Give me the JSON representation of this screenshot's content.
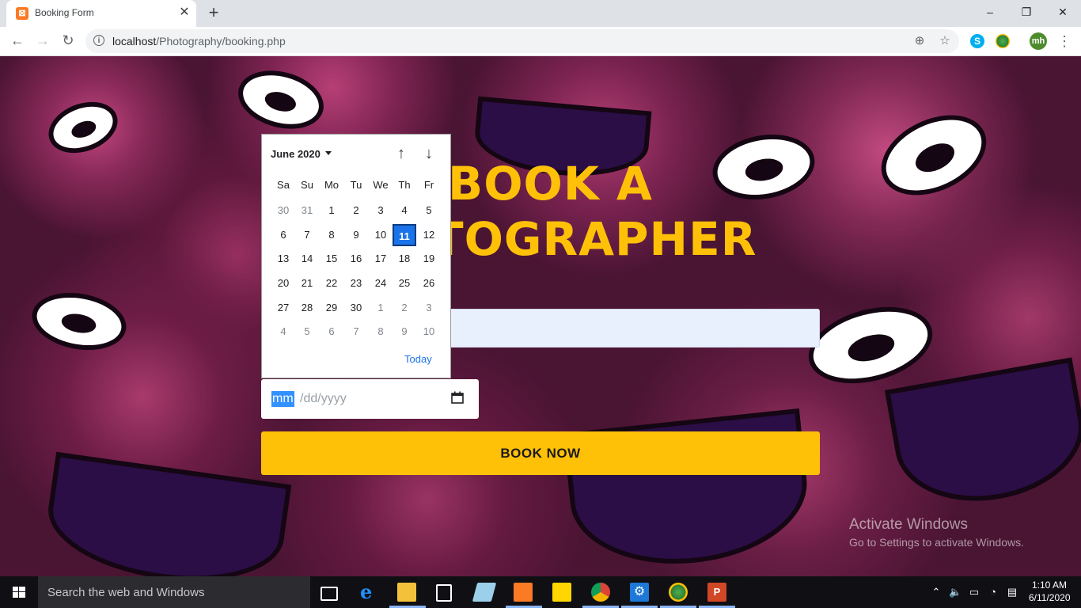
{
  "browser": {
    "tab_title": "Booking Form",
    "tab_close": "✕",
    "new_tab": "+",
    "url_host": "localhost",
    "url_path": "/Photography/booking.php",
    "avatar_initials": "mh",
    "skype_letter": "S",
    "window_controls": [
      "–",
      "❐",
      "✕"
    ]
  },
  "page": {
    "heading_line1": "BOOK A",
    "heading_line2": "TOGRAPHER",
    "date_placeholder_mm": "mm",
    "date_placeholder_rest": "/dd/yyyy",
    "book_button": "BOOK NOW"
  },
  "calendar": {
    "month_label": "June 2020",
    "weekdays": [
      "Sa",
      "Su",
      "Mo",
      "Tu",
      "We",
      "Th",
      "Fr"
    ],
    "weeks": [
      [
        "30",
        "31",
        "1",
        "2",
        "3",
        "4",
        "5"
      ],
      [
        "6",
        "7",
        "8",
        "9",
        "10",
        "11",
        "12"
      ],
      [
        "13",
        "14",
        "15",
        "16",
        "17",
        "18",
        "19"
      ],
      [
        "20",
        "21",
        "22",
        "23",
        "24",
        "25",
        "26"
      ],
      [
        "27",
        "28",
        "29",
        "30",
        "1",
        "2",
        "3"
      ],
      [
        "4",
        "5",
        "6",
        "7",
        "8",
        "9",
        "10"
      ]
    ],
    "selected_day": "11",
    "today_label": "Today"
  },
  "watermark": {
    "title": "Activate Windows",
    "subtitle": "Go to Settings to activate Windows."
  },
  "taskbar": {
    "search_placeholder": "Search the web and Windows",
    "time": "1:10 AM",
    "date": "6/11/2020"
  }
}
